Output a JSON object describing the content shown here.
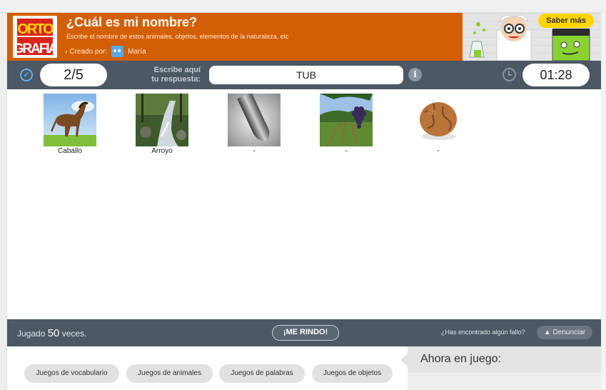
{
  "header": {
    "logo_text": "ORTOGRAFIA",
    "title": "¿Cuál es mi nombre?",
    "subtitle": "Escribe el nombre de estos animales, objetos, elementos de la naturaleza, etc",
    "creator_prefix": "Creado por:",
    "creator_name": "María",
    "promo_button": "Saber más"
  },
  "toolbar": {
    "progress": "2/5",
    "prompt_line1": "Escribe aquí",
    "prompt_line2": "tu respuesta:",
    "answer_value": "TUB",
    "timer": "01:28"
  },
  "cards": [
    {
      "label": "Caballo",
      "icon": "horse"
    },
    {
      "label": "Arroyo",
      "icon": "stream"
    },
    {
      "label": "-",
      "icon": "tube"
    },
    {
      "label": "-",
      "icon": "grapes"
    },
    {
      "label": "-",
      "icon": "walnut"
    }
  ],
  "footer": {
    "played_prefix": "Jugado",
    "played_count": "50",
    "played_suffix": "veces.",
    "surrender_button": "¡ME RINDO!",
    "bug_question": "¿Has encontrado algún fallo?",
    "report_button": "Denunciar"
  },
  "categories": [
    "Juegos de vocabulario",
    "Juegos de animales",
    "Juegos de palabras",
    "Juegos de objetos"
  ],
  "now_playing": {
    "heading": "Ahora en juego:"
  },
  "colors": {
    "header": "#d35f05",
    "bar": "#4c5864",
    "accent": "#5fb1f0",
    "promo_yellow": "#ffd400"
  }
}
